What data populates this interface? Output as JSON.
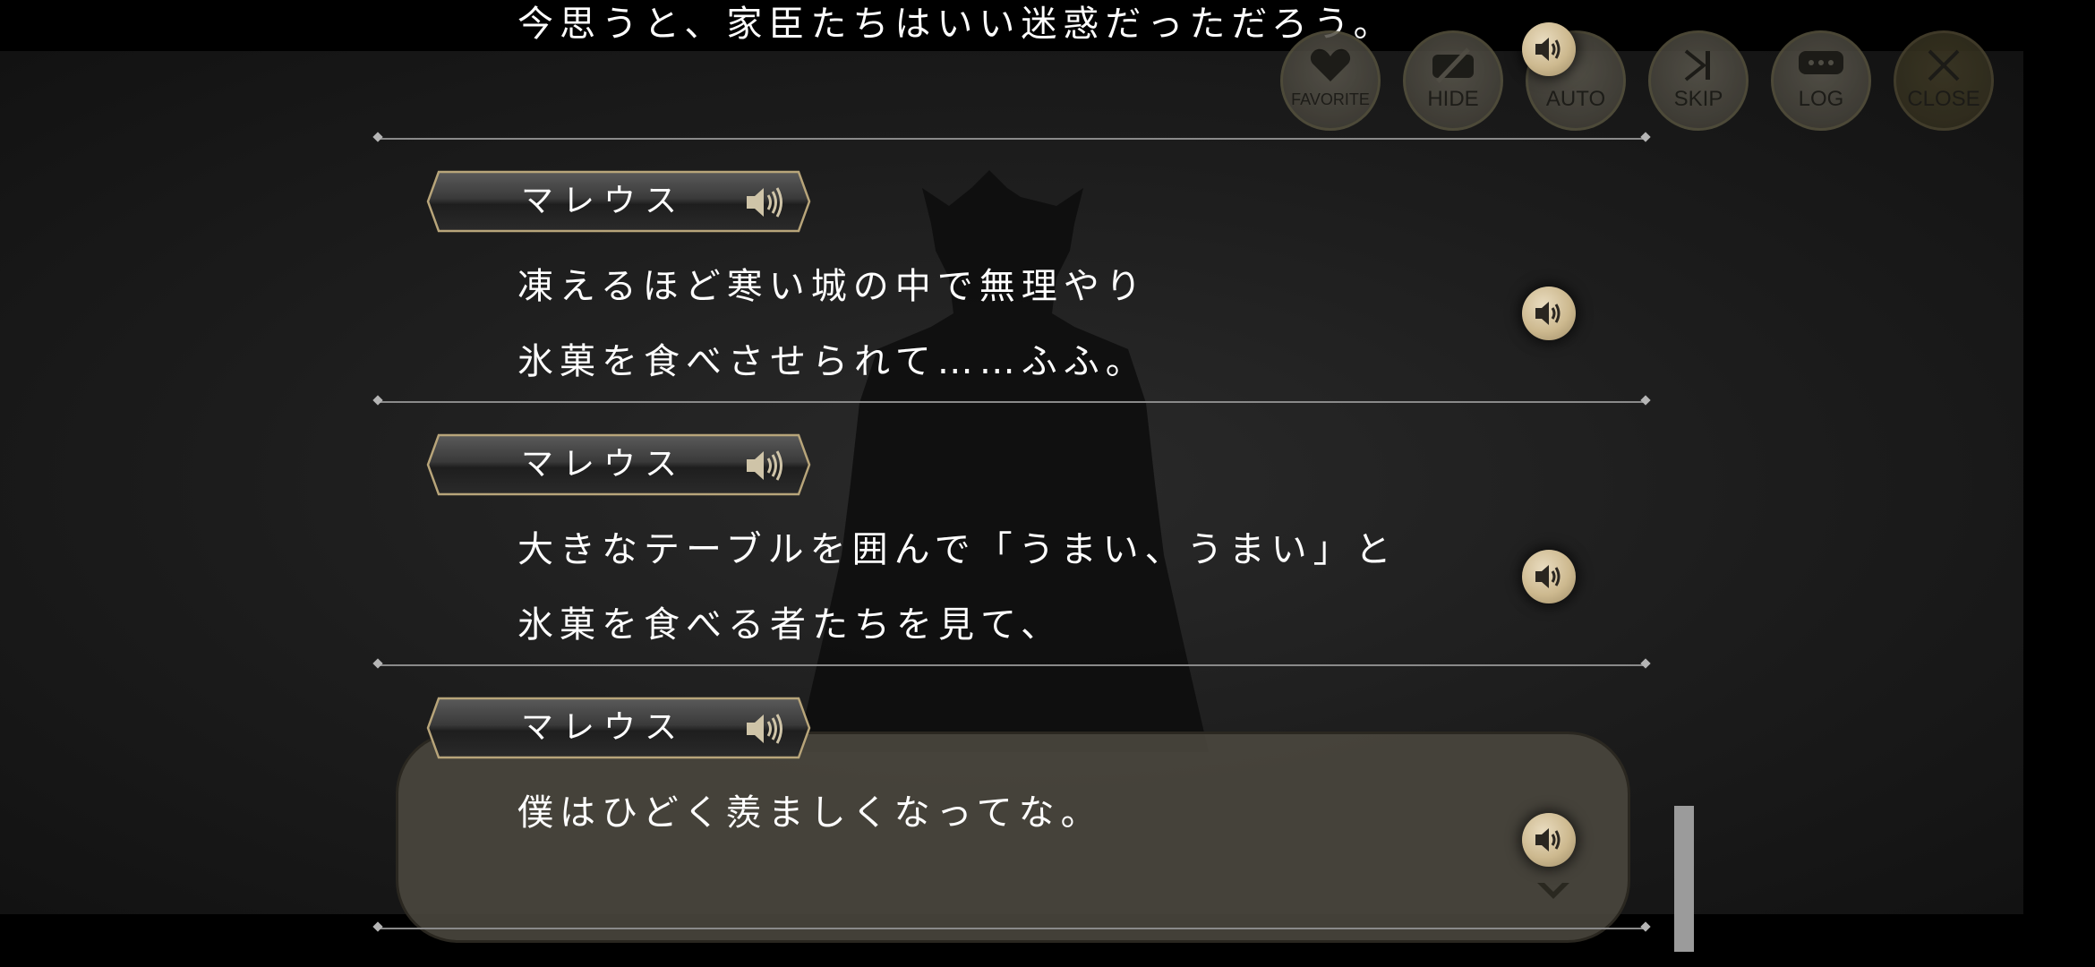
{
  "previous_line": "今思うと、家臣たちはいい迷惑だっただろう。",
  "menu": {
    "favorite": "FAVORITE",
    "hide": "HIDE",
    "auto": "AUTO",
    "skip": "SKIP",
    "log": "LOG",
    "close": "CLOSE"
  },
  "entries": [
    {
      "speaker": "マレウス",
      "lines": "凍えるほど寒い城の中で無理やり\n氷菓を食べさせられて……ふふ。"
    },
    {
      "speaker": "マレウス",
      "lines": "大きなテーブルを囲んで「うまい、うまい」と\n氷菓を食べる者たちを見て、"
    },
    {
      "speaker": "マレウス",
      "lines": "僕はひどく羨ましくなってな。"
    }
  ],
  "icons": {
    "voice": "speaker-icon",
    "favorite": "heart-icon",
    "hide": "eye-slash-icon",
    "skip": "skip-forward-icon",
    "log": "chat-bubble-icon",
    "close": "close-icon",
    "continue": "chevron-down-icon"
  },
  "colors": {
    "voice_button": "#cdb98f",
    "name_plate_border": "#b8a57a",
    "current_box": "#4a473e",
    "text": "#ffffff"
  }
}
